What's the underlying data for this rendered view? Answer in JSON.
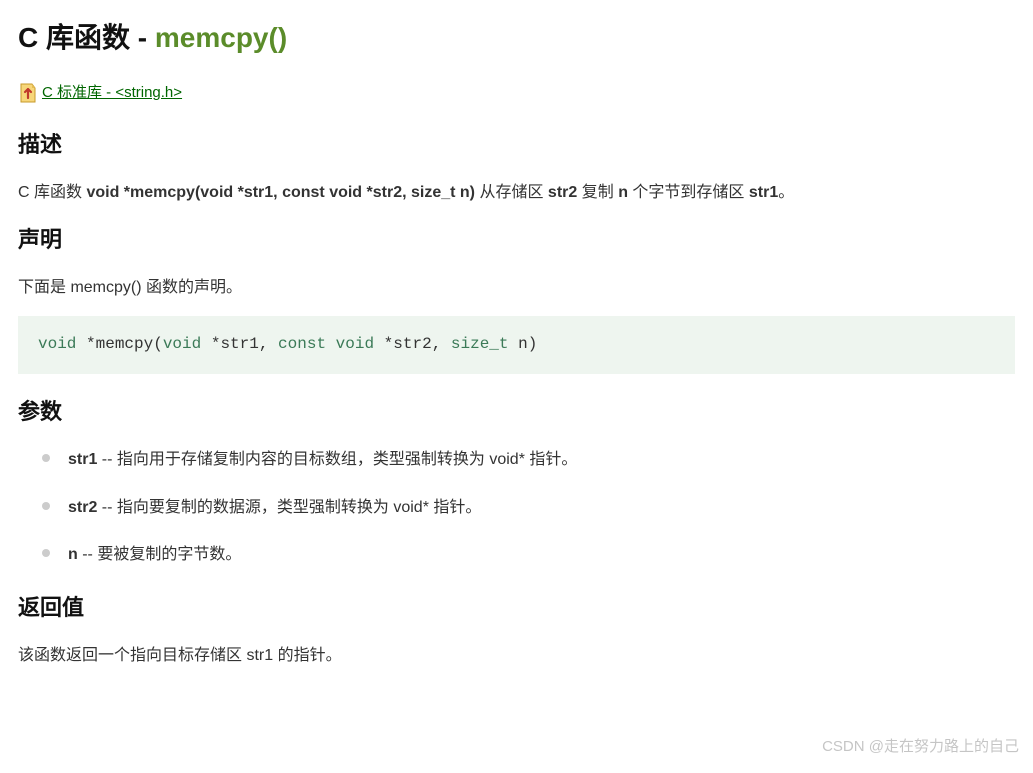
{
  "title": {
    "prefix": "C 库函数 - ",
    "func": "memcpy()"
  },
  "breadcrumb": {
    "text": " C 标准库 - <string.h>"
  },
  "sections": {
    "desc": {
      "heading": "描述",
      "p_prefix": "C 库函数 ",
      "sig": "void *memcpy(void *str1, const void *str2, size_t n)",
      "p_mid1": " 从存储区 ",
      "b1": "str2",
      "p_mid2": " 复制 ",
      "b2": "n",
      "p_mid3": " 个字节到存储区 ",
      "b3": "str1",
      "p_suffix": "。"
    },
    "decl": {
      "heading": "声明",
      "intro": "下面是 memcpy() 函数的声明。",
      "code": {
        "t1": "void",
        "t2": " *",
        "t3": "memcpy",
        "t4": "(",
        "t5": "void",
        "t6": " *",
        "t7": "str1",
        "t8": ", ",
        "t9": "const",
        "t10": " ",
        "t11": "void",
        "t12": " *",
        "t13": "str2",
        "t14": ", ",
        "t15": "size_t",
        "t16": " n)"
      }
    },
    "params": {
      "heading": "参数",
      "items": [
        {
          "name": "str1",
          "desc": " -- 指向用于存储复制内容的目标数组，类型强制转换为 void* 指针。"
        },
        {
          "name": "str2",
          "desc": " -- 指向要复制的数据源，类型强制转换为 void* 指针。"
        },
        {
          "name": "n",
          "desc": " -- 要被复制的字节数。"
        }
      ]
    },
    "ret": {
      "heading": "返回值",
      "text": "该函数返回一个指向目标存储区 str1 的指针。"
    }
  },
  "watermark": "CSDN @走在努力路上的自己"
}
